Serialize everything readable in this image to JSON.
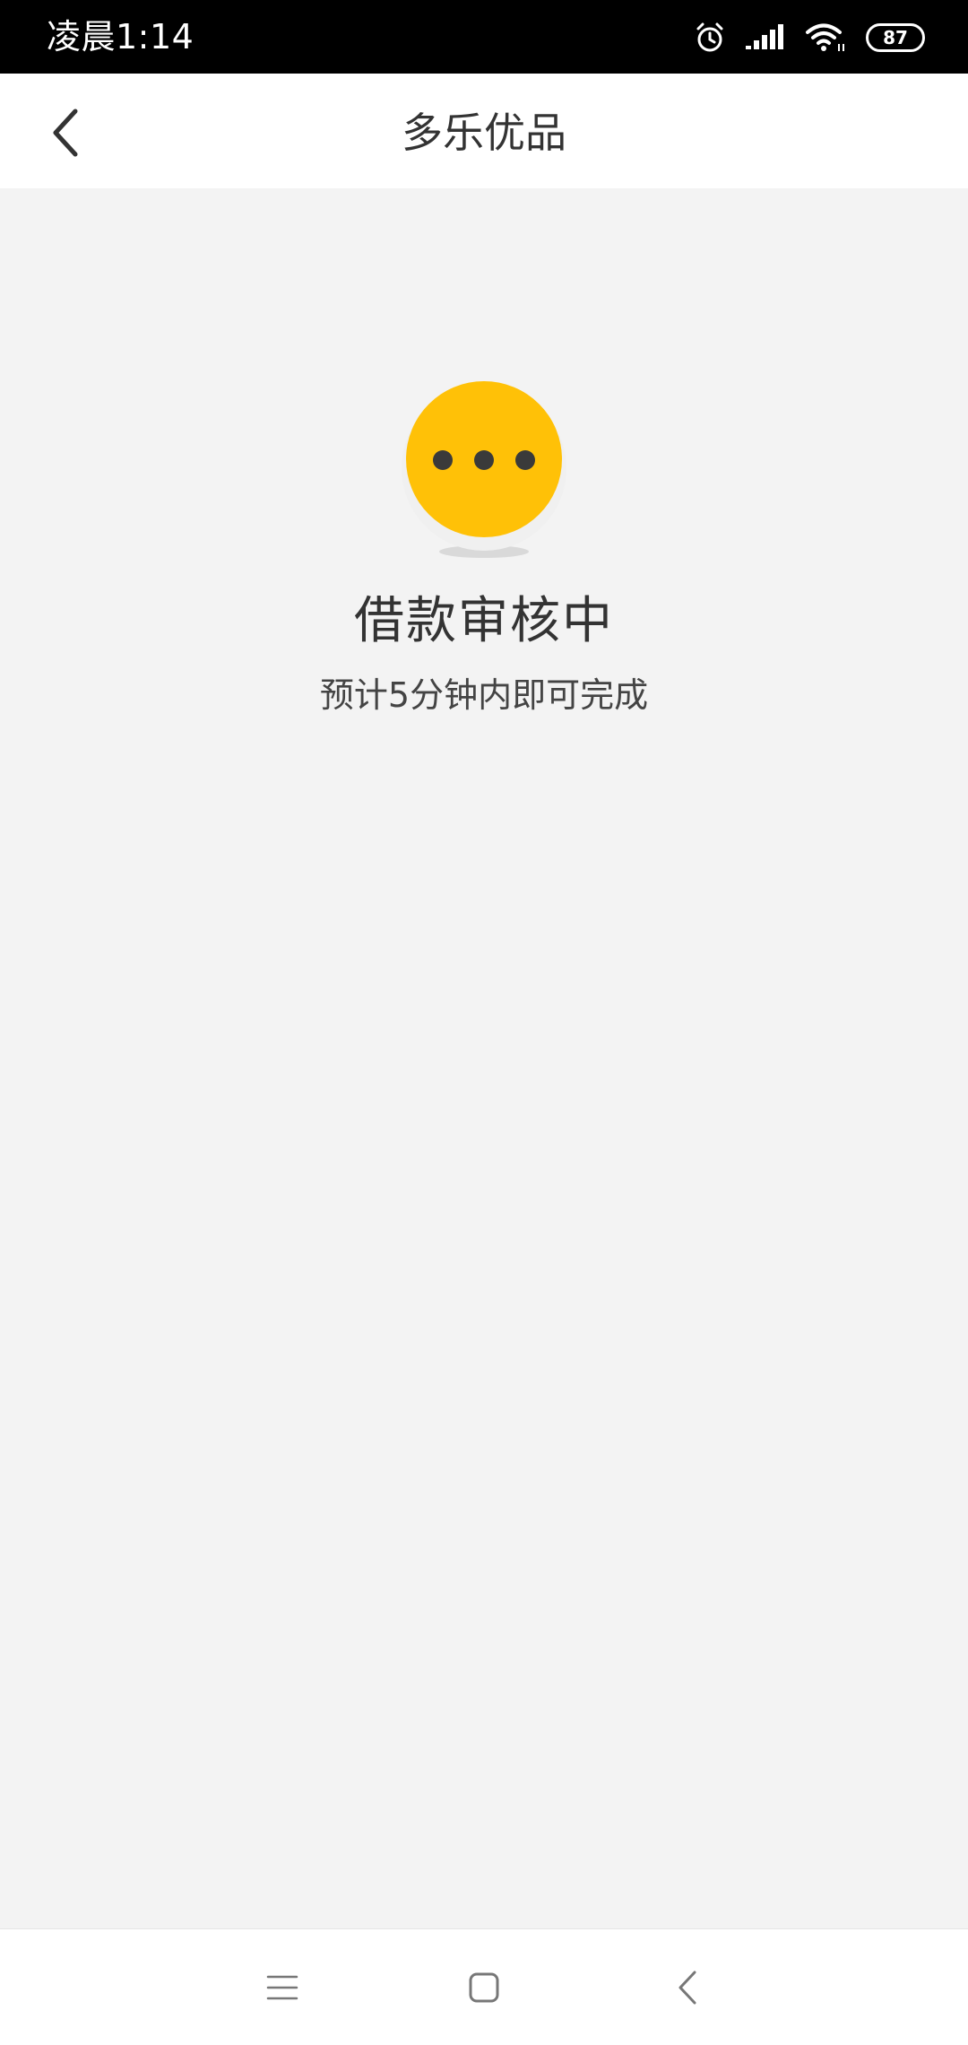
{
  "status_bar": {
    "time": "凌晨1:14",
    "battery": "87",
    "icons": [
      "alarm-icon",
      "signal-icon",
      "wifi-icon",
      "battery-icon"
    ]
  },
  "nav": {
    "title": "多乐优品",
    "back_icon": "chevron-left-icon"
  },
  "status": {
    "title": "借款审核中",
    "subtitle": "预计5分钟内即可完成",
    "icon": "pending-dots-icon"
  },
  "system_nav": {
    "icons": [
      "menu-icon",
      "home-icon",
      "back-icon"
    ]
  },
  "colors": {
    "accent": "#FFC107",
    "background": "#F3F3F3",
    "text": "#333333",
    "dots": "#3A3A3A"
  }
}
